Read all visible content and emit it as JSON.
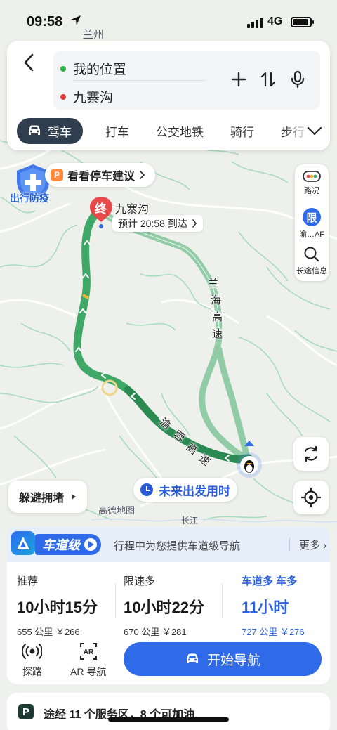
{
  "status_bar": {
    "time": "09:58",
    "network": "4G"
  },
  "map": {
    "city_label": "兰州",
    "road_label_chars_1": [
      "兰",
      "海",
      "高",
      "速"
    ],
    "road_label_chars_2": [
      "渝",
      "蓉",
      "高",
      "速"
    ],
    "credit": "高德地图",
    "river": "长江"
  },
  "search": {
    "from": "我的位置",
    "to": "九寨沟",
    "from_dot_color": "#2fb34a",
    "to_dot_color": "#e03b3b"
  },
  "modes": [
    {
      "label": "驾车",
      "active": true
    },
    {
      "label": "打车"
    },
    {
      "label": "公交地铁"
    },
    {
      "label": "骑行"
    },
    {
      "label": "步行"
    }
  ],
  "overlays": {
    "epidemic_label": "出行防疫",
    "parking_tip": "看看停车建议",
    "dest_pin_char": "终",
    "dest_name": "九寨沟",
    "eta": "预计 20:58 到达"
  },
  "side_panel": {
    "traffic_label": "路况",
    "limit_char": "限",
    "limit_label": "渝…AF",
    "info_label": "长途信息"
  },
  "bottom_controls": {
    "avoid": "躲避拥堵",
    "future": "未来出发用时"
  },
  "lane_banner": {
    "title": "车道级",
    "desc": "行程中为您提供车道级导航",
    "more": "更多 ›"
  },
  "routes": [
    {
      "tag": "推荐",
      "time": "10小时15分",
      "distance": "655 公里",
      "cost": "￥266"
    },
    {
      "tag": "限速多",
      "time": "10小时22分",
      "distance": "670 公里",
      "cost": "￥281"
    },
    {
      "tag": "车道多  车多",
      "time": "11小时",
      "distance": "727 公里",
      "cost": "￥276",
      "selected": true
    }
  ],
  "actions": {
    "explore": "探路",
    "ar": "AR 导航",
    "start": "开始导航"
  },
  "services_summary": "途经 11 个服务区，8 个可加油",
  "colors": {
    "accent": "#2f6ae8",
    "route_main": "#2e9a5a",
    "route_alt": "#7fbf98"
  }
}
